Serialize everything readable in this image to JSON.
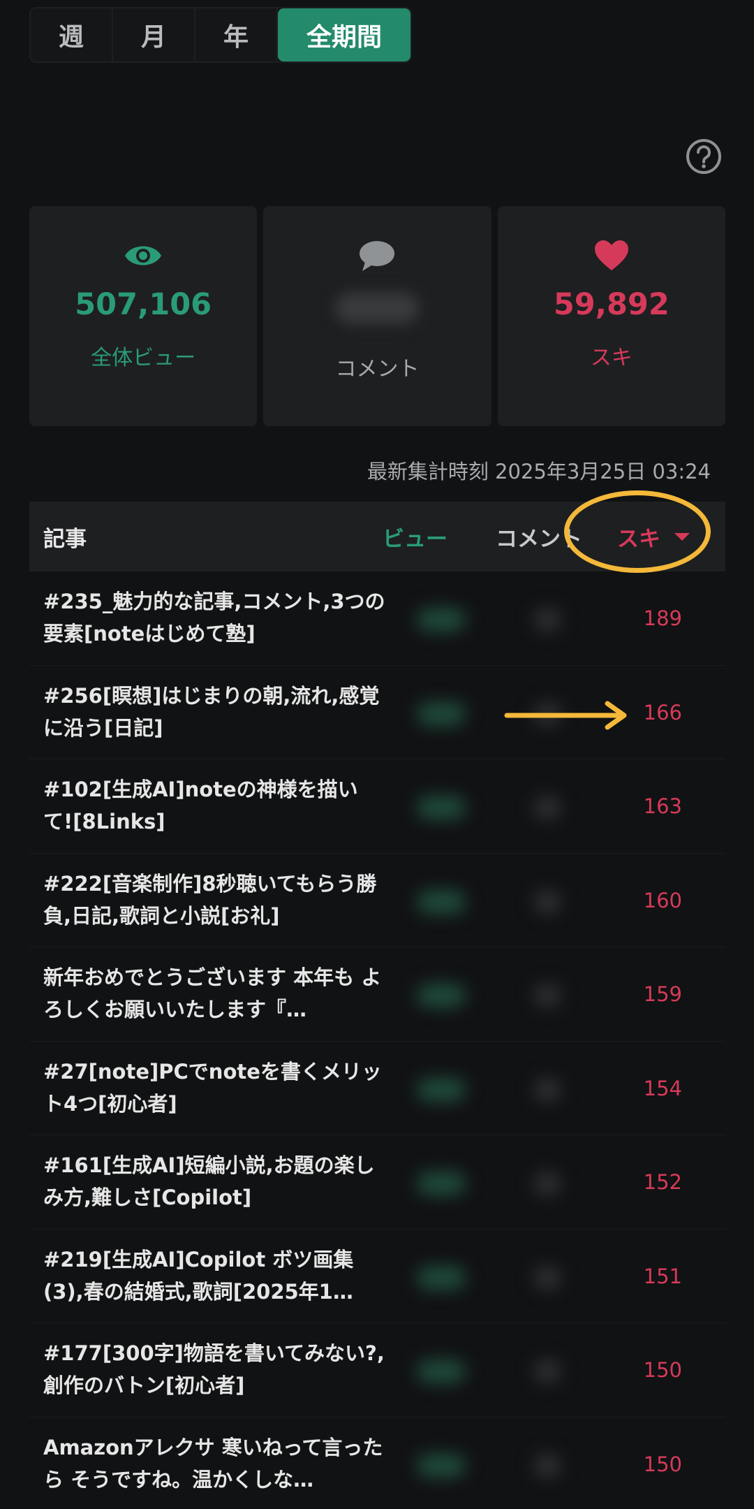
{
  "period_tabs": [
    {
      "label": "週",
      "active": false
    },
    {
      "label": "月",
      "active": false
    },
    {
      "label": "年",
      "active": false
    },
    {
      "label": "全期間",
      "active": true
    }
  ],
  "stats": {
    "views": {
      "value": "507,106",
      "label": "全体ビュー",
      "icon": "eye-icon"
    },
    "comments": {
      "label": "コメント",
      "icon": "speech-bubble-icon"
    },
    "likes": {
      "value": "59,892",
      "label": "スキ",
      "icon": "heart-icon"
    }
  },
  "updated": "最新集計時刻 2025年3月25日 03:24",
  "table": {
    "headers": {
      "article": "記事",
      "views": "ビュー",
      "comments": "コメント",
      "likes": "スキ"
    },
    "rows": [
      {
        "title": "#235_魅力的な記事,コメント,3つの要素[noteはじめて塾]",
        "likes": "189"
      },
      {
        "title": "#256[瞑想]はじまりの朝,流れ,感覚に沿う[日記]",
        "likes": "166"
      },
      {
        "title": "#102[生成AI]noteの神様を描いて![8Links]",
        "likes": "163"
      },
      {
        "title": "#222[音楽制作]8秒聴いてもらう勝負,日記,歌詞と小説[お礼]",
        "likes": "160"
      },
      {
        "title": "新年おめでとうございます 本年も よろしくお願いいたします『…",
        "likes": "159"
      },
      {
        "title": "#27[note]PCでnoteを書くメリット4つ[初心者]",
        "likes": "154"
      },
      {
        "title": "#161[生成AI]短編小説,お題の楽しみ方,難しさ[Copilot]",
        "likes": "152"
      },
      {
        "title": "#219[生成AI]Copilot ボツ画集(3),春の結婚式,歌詞[2025年1…",
        "likes": "151"
      },
      {
        "title": "#177[300字]物語を書いてみない?,創作のバトン[初心者]",
        "likes": "150"
      },
      {
        "title": "Amazonアレクサ 寒いねって言ったら そうですね。温かくしな…",
        "likes": "150"
      }
    ]
  },
  "colors": {
    "accent_green": "#238a6b",
    "like_pink": "#d63a5a",
    "annotation_yellow": "#f4b83a"
  }
}
